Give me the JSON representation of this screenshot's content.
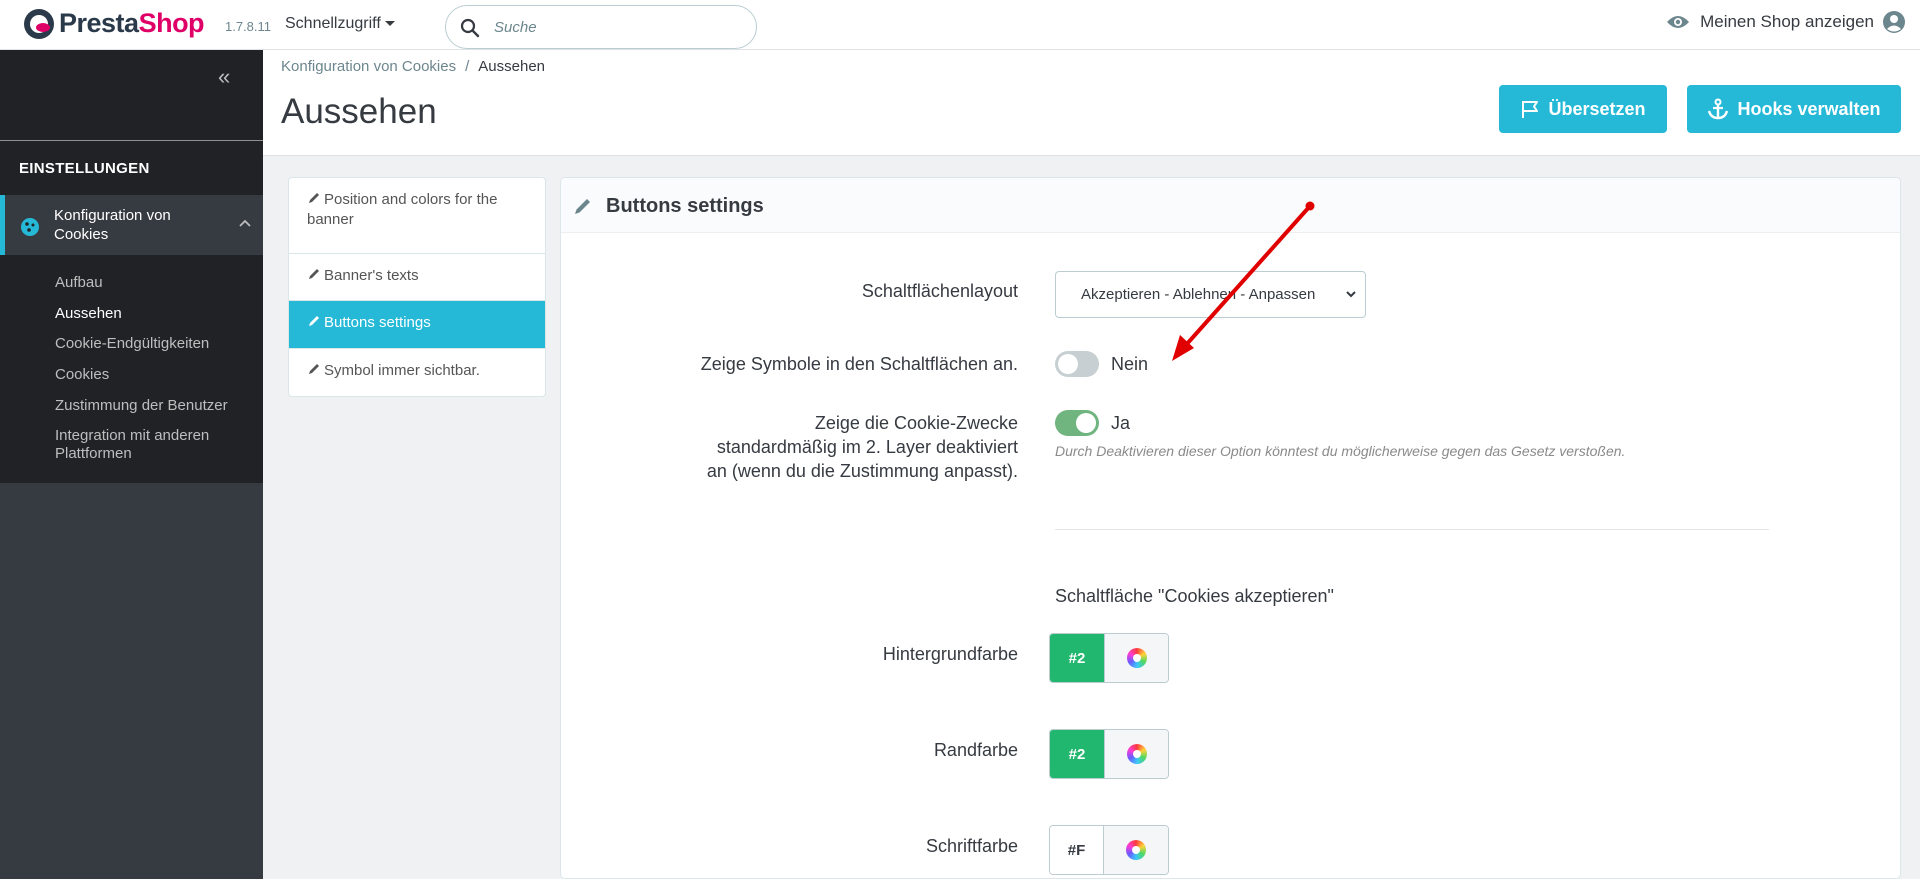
{
  "header": {
    "logo_part1": "Presta",
    "logo_part2": "Shop",
    "version": "1.7.8.11",
    "quick_access": "Schnellzugriff",
    "search_placeholder": "Suche",
    "view_shop": "Meinen Shop anzeigen"
  },
  "sidebar": {
    "collapse_icon": "«",
    "section": "EINSTELLUNGEN",
    "active_item": "Konfiguration von Cookies",
    "subitems": [
      "Aufbau",
      "Aussehen",
      "Cookie-Endgültigkeiten",
      "Cookies",
      "Zustimmung der Benutzer",
      "Integration mit anderen Plattformen"
    ]
  },
  "page": {
    "breadcrumb_parent": "Konfiguration von Cookies",
    "breadcrumb_sep": "/",
    "breadcrumb_current": "Aussehen",
    "title": "Aussehen",
    "translate_button": "Übersetzen",
    "hooks_button": "Hooks verwalten"
  },
  "tabs": [
    "Position and colors for the banner",
    "Banner's texts",
    "Buttons settings",
    "Symbol immer sichtbar."
  ],
  "panel": {
    "title": "Buttons settings",
    "layout_label": "Schaltflächenlayout",
    "layout_value": "Akzeptieren - Ablehnen - Anpassen",
    "show_icons_label": "Zeige Symbole in den Schaltflächen an.",
    "show_icons_value": "Nein",
    "purposes_label_1": "Zeige die Cookie-Zwecke",
    "purposes_label_2": "standardmäßig im 2. Layer deaktiviert",
    "purposes_label_3": "an (wenn du die Zustimmung anpasst).",
    "purposes_value": "Ja",
    "purposes_help": "Durch Deaktivieren dieser Option könntest du möglicherweise gegen das Gesetz verstoßen.",
    "accept_heading": "Schaltfläche \"Cookies akzeptieren\"",
    "bg_color_label": "Hintergrundfarbe",
    "bg_color_value": "#2",
    "border_color_label": "Randfarbe",
    "border_color_value": "#2",
    "font_color_label": "Schriftfarbe",
    "font_color_value": "#F"
  },
  "colors": {
    "accent": "#25b9d7",
    "toggle_on": "#70b580",
    "swatch_green": "#21b76f",
    "annotation_arrow": "#e00000"
  }
}
